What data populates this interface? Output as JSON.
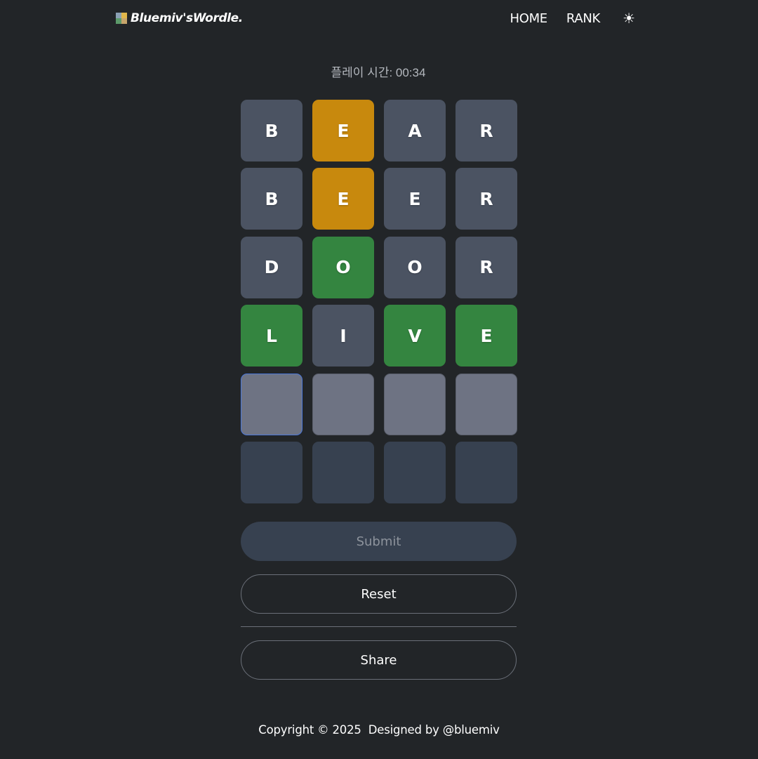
{
  "header": {
    "logo_text": "Bluemiv'sWordle.",
    "logo_icon": "wordle-logo-icon",
    "nav": {
      "home": "HOME",
      "rank": "RANK",
      "theme_icon": "☀"
    }
  },
  "timer": {
    "label": "플레이 시간: 00:34"
  },
  "board": {
    "rows": [
      [
        {
          "letter": "B",
          "state": "absent"
        },
        {
          "letter": "E",
          "state": "present"
        },
        {
          "letter": "A",
          "state": "absent"
        },
        {
          "letter": "R",
          "state": "absent"
        }
      ],
      [
        {
          "letter": "B",
          "state": "absent"
        },
        {
          "letter": "E",
          "state": "present"
        },
        {
          "letter": "E",
          "state": "absent"
        },
        {
          "letter": "R",
          "state": "absent"
        }
      ],
      [
        {
          "letter": "D",
          "state": "absent"
        },
        {
          "letter": "O",
          "state": "correct"
        },
        {
          "letter": "O",
          "state": "absent"
        },
        {
          "letter": "R",
          "state": "absent"
        }
      ],
      [
        {
          "letter": "L",
          "state": "correct"
        },
        {
          "letter": "I",
          "state": "absent"
        },
        {
          "letter": "V",
          "state": "correct"
        },
        {
          "letter": "E",
          "state": "correct"
        }
      ],
      [
        {
          "letter": "",
          "state": "active"
        },
        {
          "letter": "",
          "state": "active"
        },
        {
          "letter": "",
          "state": "active"
        },
        {
          "letter": "",
          "state": "active"
        }
      ],
      [
        {
          "letter": "",
          "state": "empty"
        },
        {
          "letter": "",
          "state": "empty"
        },
        {
          "letter": "",
          "state": "empty"
        },
        {
          "letter": "",
          "state": "empty"
        }
      ]
    ]
  },
  "colors": {
    "absent": "#4b5362",
    "present": "#c8890d",
    "correct": "#348540",
    "active": "#6e7383",
    "empty": "#374150",
    "focus": "#4c78d9"
  },
  "buttons": {
    "submit": "Submit",
    "reset": "Reset",
    "share": "Share"
  },
  "footer": {
    "copyright": "Copyright © 2025  Designed by @bluemiv"
  }
}
